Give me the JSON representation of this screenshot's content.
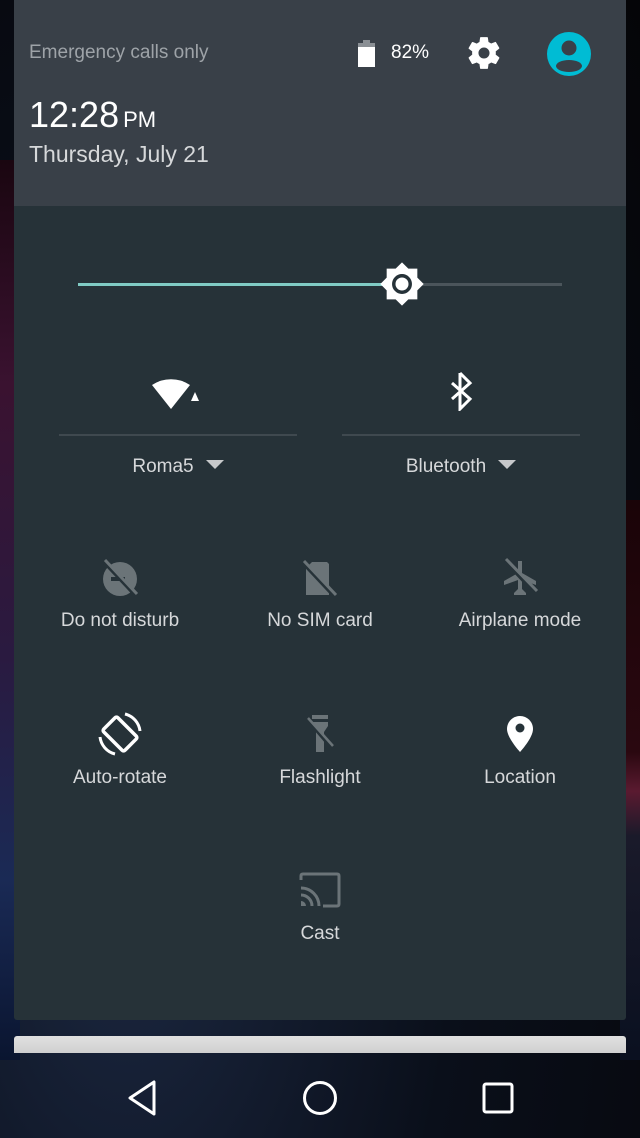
{
  "status_bar": {
    "carrier_status": "Emergency calls only",
    "battery_percent": "82%",
    "battery_level": 0.82
  },
  "header": {
    "time": "12:28",
    "ampm": "PM",
    "date": "Thursday, July 21",
    "settings_icon": "gear-icon",
    "user_icon": "account-circle-icon"
  },
  "brightness": {
    "level": 0.67,
    "icon": "brightness-icon",
    "accent_color": "#80cbc4"
  },
  "big_tiles": [
    {
      "label": "Roma5",
      "icon": "wifi-icon",
      "state": "on"
    },
    {
      "label": "Bluetooth",
      "icon": "bluetooth-icon",
      "state": "on"
    }
  ],
  "tiles": [
    {
      "label": "Do not disturb",
      "icon": "do-not-disturb-off-icon",
      "state": "off"
    },
    {
      "label": "No SIM card",
      "icon": "no-sim-icon",
      "state": "off"
    },
    {
      "label": "Airplane mode",
      "icon": "airplane-off-icon",
      "state": "off"
    },
    {
      "label": "Auto-rotate",
      "icon": "auto-rotate-icon",
      "state": "on"
    },
    {
      "label": "Flashlight",
      "icon": "flashlight-off-icon",
      "state": "off"
    },
    {
      "label": "Location",
      "icon": "location-icon",
      "state": "on"
    },
    {
      "label": "Cast",
      "icon": "cast-icon",
      "state": "off"
    }
  ],
  "navbar": {
    "back": "back-icon",
    "home": "home-icon",
    "recents": "recents-icon"
  },
  "colors": {
    "header_bg": "#394048",
    "panel_bg": "#263238",
    "active_icon": "#ffffff",
    "inactive_icon": "#6b7478",
    "avatar": "#00bcd4"
  }
}
